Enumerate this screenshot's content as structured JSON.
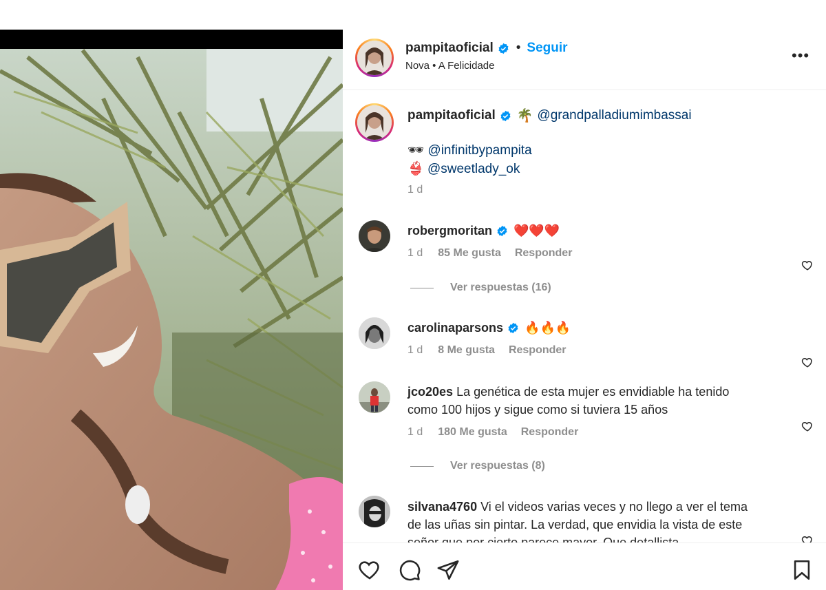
{
  "post": {
    "author": "pampitaoficial",
    "follow_label": "Seguir",
    "separator": "•",
    "location": "Nova • A Felicidade",
    "more_label": "•••"
  },
  "caption": {
    "author": "pampitaoficial",
    "line1_emoji": "🌴",
    "line1_mention": "@grandpalladiumimbassai",
    "line2_emoji": "🕶",
    "line2_mention": "@infinitbypampita",
    "line3_emoji": "👙",
    "line3_mention": "@sweetlady_ok",
    "time": "1 d"
  },
  "comments": [
    {
      "user": "robergmoritan",
      "verified": true,
      "text": "❤️❤️❤️",
      "time": "1 d",
      "likes": "85 Me gusta",
      "reply": "Responder",
      "view_replies": "Ver respuestas (16)"
    },
    {
      "user": "carolinaparsons",
      "verified": true,
      "text": "🔥🔥🔥",
      "time": "1 d",
      "likes": "8 Me gusta",
      "reply": "Responder"
    },
    {
      "user": "jco20es",
      "verified": false,
      "text_line1": "La genética de esta mujer es envidiable ha tenido",
      "text_line2": "como 100 hijos y sigue como si tuviera 15 años",
      "time": "1 d",
      "likes": "180 Me gusta",
      "reply": "Responder",
      "view_replies": "Ver respuestas (8)"
    },
    {
      "user": "silvana4760",
      "verified": false,
      "text_line1": "Vi el videos varias veces y no llego a ver el tema",
      "text_line2": "de las uñas sin pintar. La verdad, que envidia la vista de este",
      "text_line3": "señor que por cierto parece mayor. Que detallista"
    }
  ],
  "icons": {
    "like": "heart-icon",
    "comment": "comment-icon",
    "share": "share-icon",
    "save": "bookmark-icon",
    "verified": "verified-badge-icon"
  },
  "colors": {
    "accent": "#0095f6",
    "mention": "#00376b",
    "muted": "#8e8e8e",
    "verified": "#0095f6"
  }
}
